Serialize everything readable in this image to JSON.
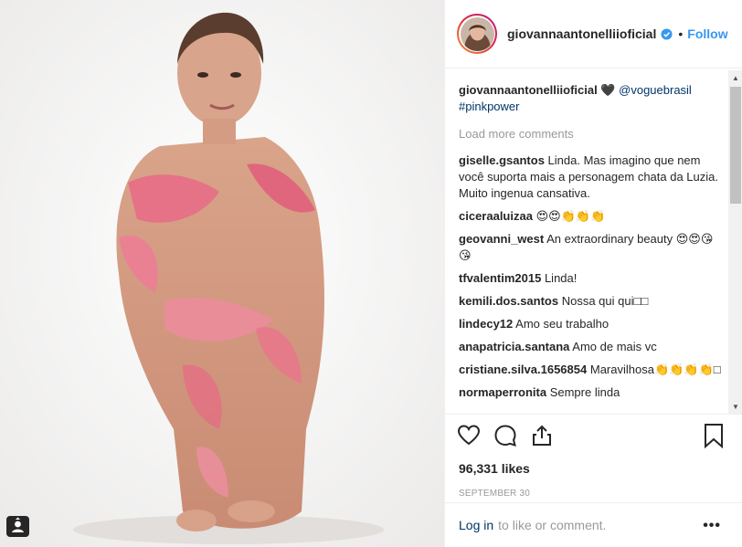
{
  "post": {
    "username": "giovannaantonelliioficial",
    "follow_label": "Follow",
    "separator": "•"
  },
  "caption": {
    "username": "giovannaantonelliioficial",
    "emoji": "🖤",
    "mention": "@voguebrasil",
    "hashtag": "#pinkpower"
  },
  "load_more_label": "Load more comments",
  "comments": [
    {
      "user": "giselle.gsantos",
      "text": "Linda. Mas imagino que nem você suporta mais a personagem chata da Luzia. Muito ingenua cansativa."
    },
    {
      "user": "ciceraaluizaa",
      "text": "😍😍👏👏👏"
    },
    {
      "user": "geovanni_west",
      "text": "An extraordinary beauty 😍😍😘😘"
    },
    {
      "user": "tfvalentim2015",
      "text": "Linda!"
    },
    {
      "user": "kemili.dos.santos",
      "text": "Nossa qui qui□□"
    },
    {
      "user": "lindecy12",
      "text": "Amo seu trabalho"
    },
    {
      "user": "anapatricia.santana",
      "text": "Amo de mais vc"
    },
    {
      "user": "cristiane.silva.1656854",
      "text": "Maravilhosa👏👏👏👏□"
    },
    {
      "user": "normaperronita",
      "text": "Sempre linda"
    }
  ],
  "likes_text": "96,331 likes",
  "date_text": "SEPTEMBER 30",
  "login": {
    "link_label": "Log in",
    "suffix": "to like or comment."
  },
  "more_label": "•••",
  "colors": {
    "link_blue": "#3897f0",
    "mention_blue": "#003569",
    "muted": "#999999",
    "text": "#262626"
  },
  "icons": [
    "user-tag-icon",
    "verified-badge-icon",
    "heart-icon",
    "comment-icon",
    "share-icon",
    "bookmark-icon",
    "more-options-icon"
  ]
}
